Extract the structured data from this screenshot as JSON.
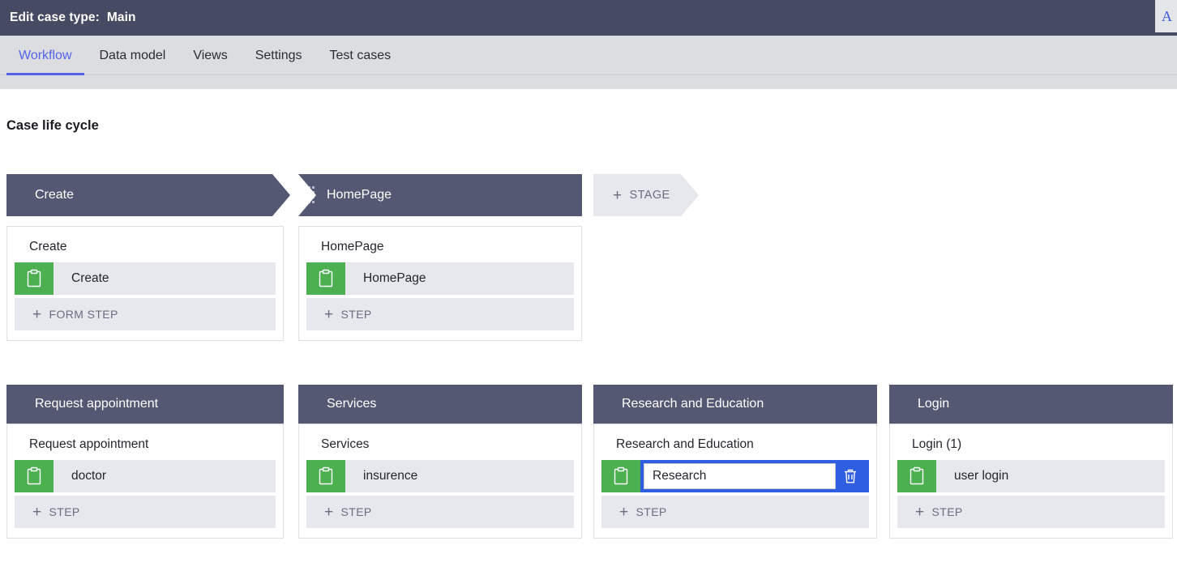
{
  "topbar": {
    "label": "Edit case type:",
    "case_name": "Main",
    "panel_letter": "A"
  },
  "tabs": [
    {
      "label": "Workflow",
      "active": true
    },
    {
      "label": "Data model",
      "active": false
    },
    {
      "label": "Views",
      "active": false
    },
    {
      "label": "Settings",
      "active": false
    },
    {
      "label": "Test cases",
      "active": false
    }
  ],
  "page": {
    "heading": "Case life cycle"
  },
  "stages": [
    {
      "label": "Create",
      "handle": false,
      "active": true
    },
    {
      "label": "HomePage",
      "handle": true,
      "active": false
    }
  ],
  "add_stage": {
    "plus": "+",
    "label": "STAGE"
  },
  "cards": [
    {
      "stage_label": "Create",
      "title": "Create",
      "icon": "clipboard-icon",
      "steps": [
        {
          "name": "Create",
          "editing": false
        }
      ],
      "add_step_label": "FORM STEP",
      "add_step_plus": "+"
    },
    {
      "stage_label": "HomePage",
      "title": "HomePage",
      "icon": "clipboard-icon",
      "steps": [
        {
          "name": "HomePage",
          "editing": false
        }
      ],
      "add_step_label": "STEP",
      "add_step_plus": "+"
    },
    {
      "stage_label": "Request appointment",
      "title": "Request appointment",
      "icon": "clipboard-icon",
      "steps": [
        {
          "name": "doctor",
          "editing": false
        }
      ],
      "add_step_label": "STEP",
      "add_step_plus": "+"
    },
    {
      "stage_label": "Services",
      "title": "Services",
      "icon": "clipboard-icon",
      "steps": [
        {
          "name": "insurence",
          "editing": false
        }
      ],
      "add_step_label": "STEP",
      "add_step_plus": "+"
    },
    {
      "stage_label": "Research and Education",
      "title": "Research and Education",
      "icon": "clipboard-icon",
      "steps": [
        {
          "name": "Research",
          "editing": true,
          "delete_icon": "trash-icon"
        }
      ],
      "add_step_label": "STEP",
      "add_step_plus": "+"
    },
    {
      "stage_label": "Login",
      "title": "Login (1)",
      "icon": "clipboard-icon",
      "steps": [
        {
          "name": "user login",
          "editing": false
        }
      ],
      "add_step_label": "STEP",
      "add_step_plus": "+"
    }
  ],
  "colors": {
    "topbar": "#474a63",
    "tabbar": "#dcdde1",
    "accent": "#5562e8",
    "stage": "#555873",
    "green": "#4caf50",
    "edit_blue": "#2f5fe0",
    "row_gray": "#e7e8ed"
  }
}
